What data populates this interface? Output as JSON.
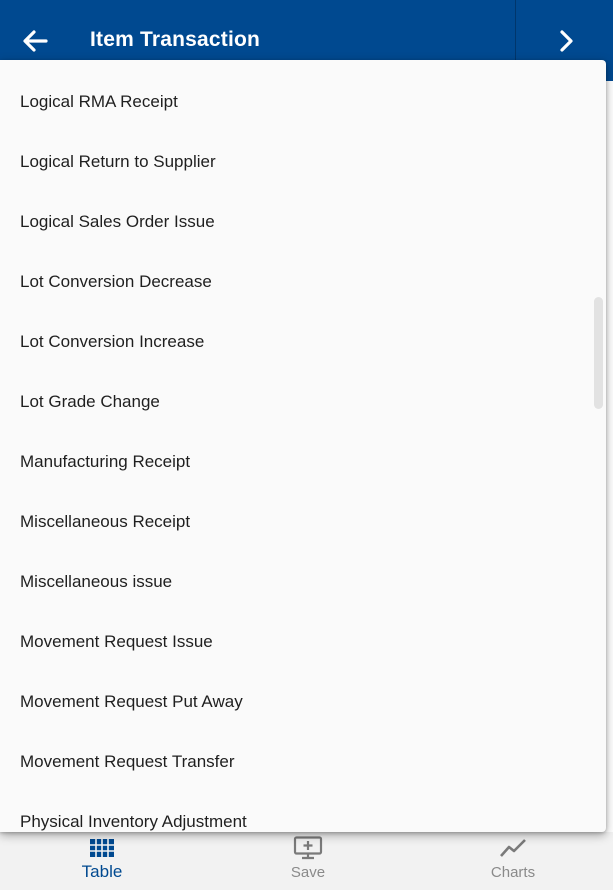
{
  "header": {
    "title": "Item Transaction",
    "back_icon": "arrow-left-icon",
    "next_icon": "chevron-right-icon",
    "background": "#004990"
  },
  "dropdown": {
    "options": [
      "Logical RMA Receipt",
      "Logical Return to Supplier",
      "Logical Sales Order Issue",
      "Lot Conversion Decrease",
      "Lot Conversion Increase",
      "Lot Grade Change",
      "Manufacturing Receipt",
      "Miscellaneous Receipt",
      "Miscellaneous issue",
      "Movement Request Issue",
      "Movement Request Put Away",
      "Movement Request Transfer",
      "Physical Inventory Adjustment"
    ]
  },
  "bottom_nav": {
    "items": [
      {
        "label": "Table",
        "icon": "table-grid-icon",
        "active": true
      },
      {
        "label": "Save",
        "icon": "monitor-add-icon",
        "active": false
      },
      {
        "label": "Charts",
        "icon": "line-chart-icon",
        "active": false
      }
    ],
    "active_color": "#004990",
    "inactive_color": "#8a8a8a"
  }
}
